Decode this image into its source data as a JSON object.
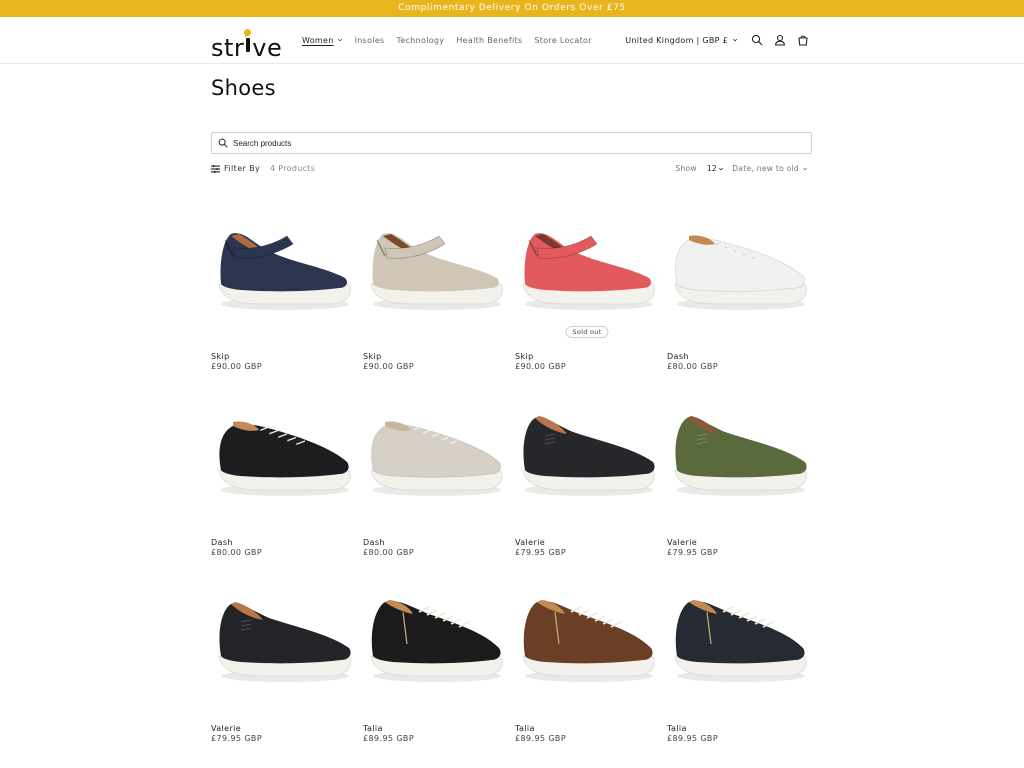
{
  "announcement": "Complimentary Delivery On Orders Over £75",
  "brand": {
    "logo_left": "str",
    "logo_right": "ve",
    "accent": "#e8b51d"
  },
  "nav": {
    "items": [
      {
        "label": "Women",
        "active": true,
        "dropdown": true
      },
      {
        "label": "Insoles"
      },
      {
        "label": "Technology"
      },
      {
        "label": "Health Benefits"
      },
      {
        "label": "Store Locator"
      }
    ]
  },
  "header": {
    "country": "United Kingdom | GBP £",
    "icons": [
      "search-icon",
      "account-icon",
      "cart-icon"
    ]
  },
  "page": {
    "title": "Shoes"
  },
  "search": {
    "placeholder": "Search products"
  },
  "toolbar": {
    "filter_label": "Filter By",
    "count": "4 Products",
    "show_label": "Show",
    "show_value": "12",
    "sort_label": "Date, new to old"
  },
  "products": [
    {
      "name": "Skip",
      "price": "£90.00 GBP",
      "upper": "#2b3550",
      "trim": "#b06a3b",
      "style": "mary-jane"
    },
    {
      "name": "Skip",
      "price": "£90.00 GBP",
      "upper": "#cfc6b6",
      "trim": "#7a4a2c",
      "style": "mary-jane"
    },
    {
      "name": "Skip",
      "price": "£90.00 GBP",
      "upper": "#e25a5d",
      "trim": "#7a3a2c",
      "style": "mary-jane",
      "badge": "Sold out"
    },
    {
      "name": "Dash",
      "price": "£80.00 GBP",
      "upper": "#f1f1ef",
      "trim": "#c48a55",
      "style": "laced"
    },
    {
      "name": "Dash",
      "price": "£80.00 GBP",
      "upper": "#1d1d1f",
      "trim": "#c48a55",
      "style": "laced"
    },
    {
      "name": "Dash",
      "price": "£80.00 GBP",
      "upper": "#d6d0c6",
      "trim": "#c9b59a",
      "style": "laced"
    },
    {
      "name": "Valerie",
      "price": "£79.95 GBP",
      "upper": "#25272b",
      "trim": "#b7774a",
      "style": "slipon"
    },
    {
      "name": "Valerie",
      "price": "£79.95 GBP",
      "upper": "#5b6a3c",
      "trim": "#8a5a3a",
      "style": "slipon"
    },
    {
      "name": "Valerie",
      "price": "£79.95 GBP",
      "upper": "#222428",
      "trim": "#b7774a",
      "style": "slipon"
    },
    {
      "name": "Talia",
      "price": "£89.95 GBP",
      "upper": "#1b1b1b",
      "trim": "#c48a55",
      "style": "zip-laced"
    },
    {
      "name": "Talia",
      "price": "£89.95 GBP",
      "upper": "#6a3f26",
      "trim": "#c48a55",
      "style": "zip-laced"
    },
    {
      "name": "Talia",
      "price": "£89.95 GBP",
      "upper": "#262a33",
      "trim": "#c48a55",
      "style": "zip-laced"
    }
  ]
}
